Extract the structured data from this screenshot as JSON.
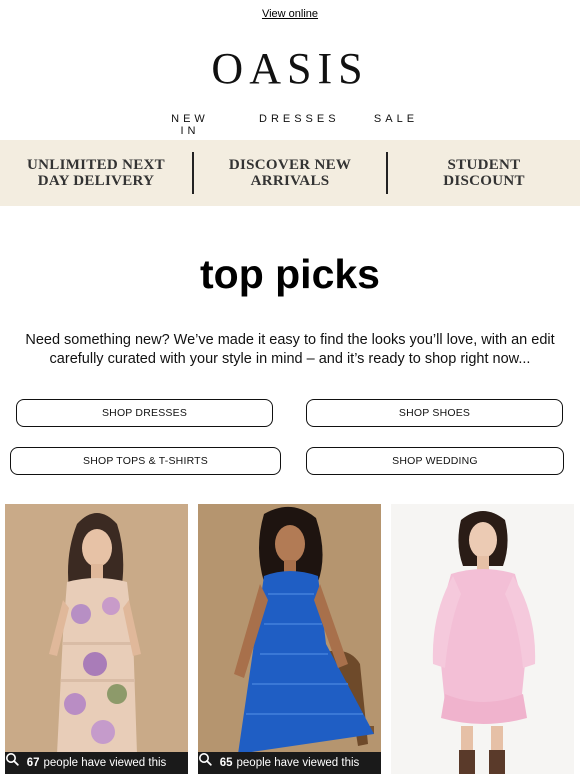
{
  "header": {
    "view_online": "View online",
    "logo": "OASIS"
  },
  "nav": {
    "items": [
      "NEW IN",
      "DRESSES",
      "SALE"
    ]
  },
  "promo": {
    "items": [
      {
        "line1": "UNLIMITED NEXT",
        "line2": "DAY DELIVERY"
      },
      {
        "line1": "DISCOVER NEW",
        "line2": "ARRIVALS"
      },
      {
        "line1": "STUDENT",
        "line2": "DISCOUNT"
      }
    ]
  },
  "main": {
    "headline": "top picks",
    "intro": "Need something new? We’ve made it easy to find the looks you’ll love, with an edit carefully curated with your style in mind – and it’s ready to shop right now...",
    "buttons": [
      "SHOP DRESSES",
      "SHOP SHOES",
      "SHOP TOPS & T-SHIRTS",
      "SHOP WEDDING"
    ]
  },
  "products": [
    {
      "count": "67",
      "suffix": "people have viewed this",
      "icon": "search-icon",
      "dress_color": "#c8a6c8"
    },
    {
      "count": "65",
      "suffix": "people have viewed this",
      "icon": "search-icon",
      "dress_color": "#1f5ec4"
    },
    {
      "count": "",
      "suffix": "",
      "icon": "search-icon",
      "dress_color": "#f3bfd6"
    }
  ],
  "colors": {
    "promo_bg": "#f3ede0",
    "badge_bg": "#1a1a1a"
  }
}
